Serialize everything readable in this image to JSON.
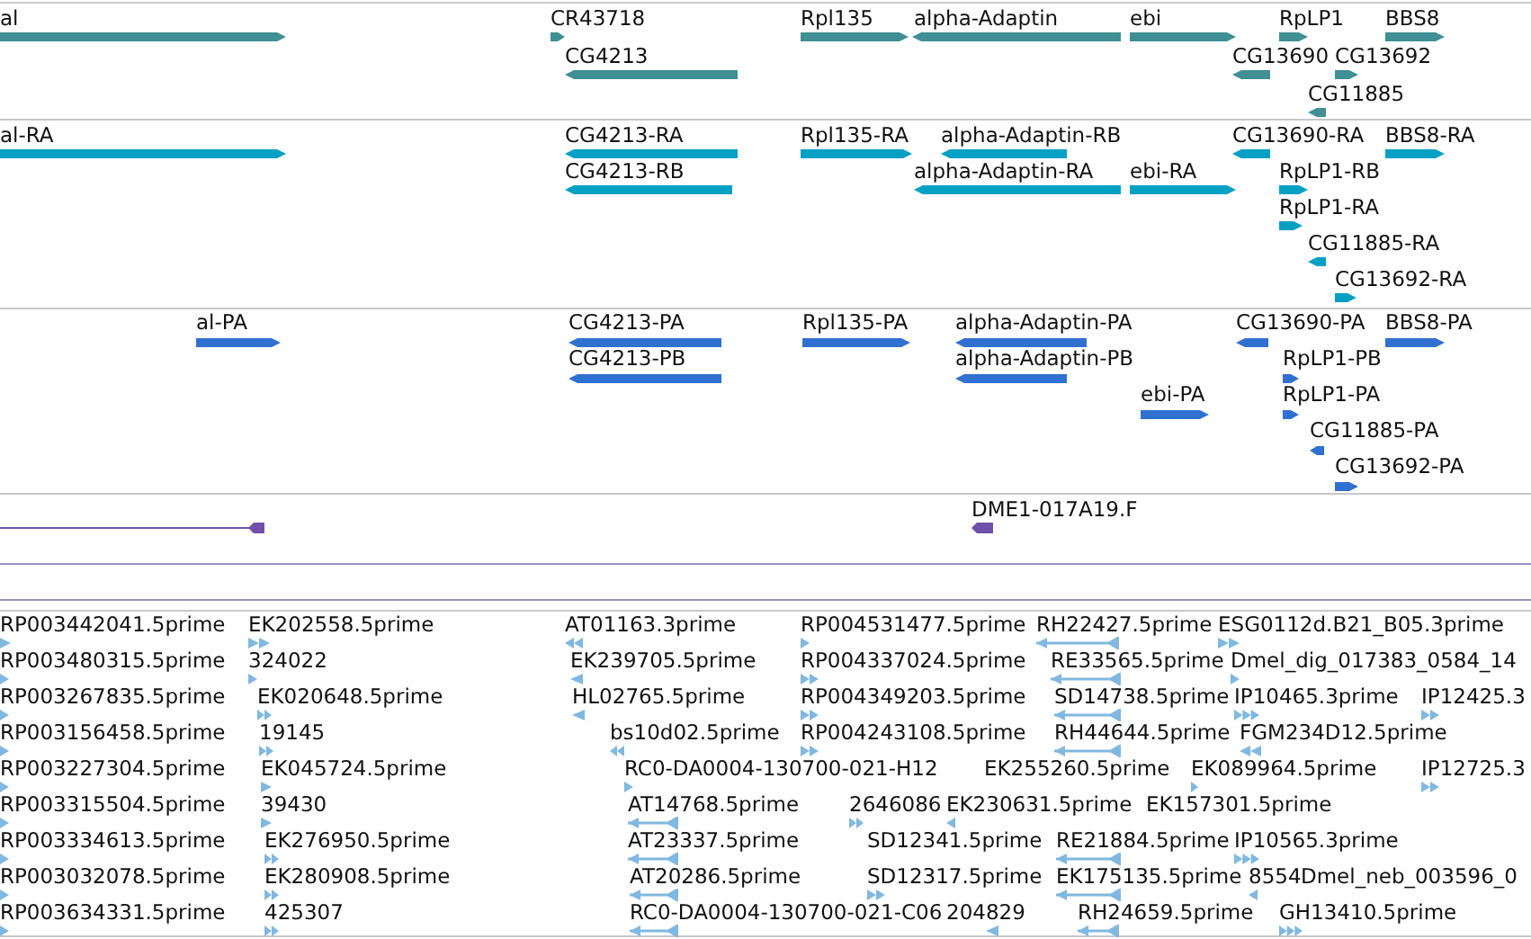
{
  "tracks": [
    {
      "kind": "block",
      "color": "#3f8f94",
      "features": [
        {
          "label": "al",
          "reverse": false
        },
        {
          "label": "CR43718",
          "reverse": false
        },
        {
          "label": "Rpl135",
          "reverse": false
        },
        {
          "label": "alpha-Adaptin",
          "reverse": true
        },
        {
          "label": "ebi",
          "reverse": false
        },
        {
          "label": "RpLP1",
          "reverse": false
        },
        {
          "label": "BBS8",
          "reverse": false
        },
        {
          "label": "CG4213",
          "reverse": true
        },
        {
          "label": "CG13690",
          "reverse": true
        },
        {
          "label": "CG13692",
          "reverse": false
        },
        {
          "label": "CG11885",
          "reverse": true
        }
      ]
    },
    {
      "kind": "block",
      "color": "#00a0c4",
      "features": [
        {
          "label": "al-RA",
          "reverse": false
        },
        {
          "label": "CG4213-RA",
          "reverse": true
        },
        {
          "label": "Rpl135-RA",
          "reverse": false
        },
        {
          "label": "alpha-Adaptin-RB",
          "reverse": true
        },
        {
          "label": "CG13690-RA",
          "reverse": true
        },
        {
          "label": "BBS8-RA",
          "reverse": false
        },
        {
          "label": "CG4213-RB",
          "reverse": true
        },
        {
          "label": "alpha-Adaptin-RA",
          "reverse": true
        },
        {
          "label": "ebi-RA",
          "reverse": false
        },
        {
          "label": "RpLP1-RB",
          "reverse": false
        },
        {
          "label": "RpLP1-RA",
          "reverse": false
        },
        {
          "label": "CG11885-RA",
          "reverse": true
        },
        {
          "label": "CG13692-RA",
          "reverse": false
        }
      ]
    },
    {
      "kind": "block",
      "color": "#3070d0",
      "features": [
        {
          "label": "al-PA",
          "reverse": false
        },
        {
          "label": "CG4213-PA",
          "reverse": true
        },
        {
          "label": "Rpl135-PA",
          "reverse": false
        },
        {
          "label": "alpha-Adaptin-PA",
          "reverse": true
        },
        {
          "label": "CG13690-PA",
          "reverse": true
        },
        {
          "label": "BBS8-PA",
          "reverse": false
        },
        {
          "label": "CG4213-PB",
          "reverse": true
        },
        {
          "label": "alpha-Adaptin-PB",
          "reverse": true
        },
        {
          "label": "RpLP1-PB",
          "reverse": false
        },
        {
          "label": "ebi-PA",
          "reverse": false
        },
        {
          "label": "RpLP1-PA",
          "reverse": false
        },
        {
          "label": "CG11885-PA",
          "reverse": true
        },
        {
          "label": "CG13692-PA",
          "reverse": false
        }
      ]
    },
    {
      "kind": "line",
      "color": "#7050a8",
      "features": [
        {
          "reverse": true
        },
        {
          "label": "DME1-017A19.F",
          "reverse": true
        }
      ]
    },
    {
      "kind": "read",
      "color": "#80b8e0",
      "features": [
        {
          "label": "RP003442041.5prime",
          "reverse": false
        },
        {
          "label": "EK202558.5prime",
          "reverse": false
        },
        {
          "label": "AT01163.3prime",
          "reverse": true
        },
        {
          "label": "RP004531477.5prime",
          "reverse": false
        },
        {
          "label": "RH22427.5prime",
          "reverse": true
        },
        {
          "label": "ESG0112d.B21_B05.3prime",
          "reverse": false
        },
        {
          "label": "RP003480315.5prime",
          "reverse": false
        },
        {
          "label": "324022",
          "reverse": false
        },
        {
          "label": "EK239705.5prime",
          "reverse": true
        },
        {
          "label": "RP004337024.5prime",
          "reverse": false
        },
        {
          "label": "RE33565.5prime",
          "reverse": true
        },
        {
          "label": "Dmel_dig_017383_0584_14",
          "reverse": false
        },
        {
          "label": "RP003267835.5prime",
          "reverse": false
        },
        {
          "label": "EK020648.5prime",
          "reverse": false
        },
        {
          "label": "HL02765.5prime",
          "reverse": true
        },
        {
          "label": "RP004349203.5prime",
          "reverse": false
        },
        {
          "label": "SD14738.5prime",
          "reverse": true
        },
        {
          "label": "IP10465.3prime",
          "reverse": false
        },
        {
          "label": "IP12425.3",
          "reverse": false
        },
        {
          "label": "RP003156458.5prime",
          "reverse": false
        },
        {
          "label": "19145",
          "reverse": false
        },
        {
          "label": "bs10d02.5prime",
          "reverse": true
        },
        {
          "label": "RP004243108.5prime",
          "reverse": false
        },
        {
          "label": "RH44644.5prime",
          "reverse": true
        },
        {
          "label": "FGM234D12.5prime",
          "reverse": true
        },
        {
          "label": "RP003227304.5prime",
          "reverse": false
        },
        {
          "label": "EK045724.5prime",
          "reverse": false
        },
        {
          "label": "RC0-DA0004-130700-021-H12",
          "reverse": false
        },
        {
          "label": "EK255260.5prime"
        },
        {
          "label": "EK089964.5prime",
          "reverse": false
        },
        {
          "label": "IP12725.3",
          "reverse": false
        },
        {
          "label": "RP003315504.5prime",
          "reverse": false
        },
        {
          "label": "39430",
          "reverse": false
        },
        {
          "label": "AT14768.5prime",
          "reverse": true
        },
        {
          "label": "2646086",
          "reverse": false
        },
        {
          "label": "EK230631.5prime",
          "reverse": true
        },
        {
          "label": "EK157301.5prime"
        },
        {
          "label": "RP003334613.5prime",
          "reverse": false
        },
        {
          "label": "EK276950.5prime",
          "reverse": false
        },
        {
          "label": "AT23337.5prime",
          "reverse": true
        },
        {
          "label": "SD12341.5prime"
        },
        {
          "label": "RE21884.5prime",
          "reverse": true
        },
        {
          "label": "IP10565.3prime",
          "reverse": false
        },
        {
          "label": "RP003032078.5prime",
          "reverse": false
        },
        {
          "label": "EK280908.5prime",
          "reverse": false
        },
        {
          "label": "AT20286.5prime",
          "reverse": true
        },
        {
          "label": "SD12317.5prime",
          "reverse": false
        },
        {
          "label": "EK175135.5prime",
          "reverse": true
        },
        {
          "label": "8554",
          "reverse": true
        },
        {
          "label": "Dmel_neb_003596_0"
        },
        {
          "label": "RP003634331.5prime",
          "reverse": false
        },
        {
          "label": "425307",
          "reverse": false
        },
        {
          "label": "RC0-DA0004-130700-021-C06",
          "reverse": true
        },
        {
          "label": "204829",
          "reverse": true
        },
        {
          "label": "RH24659.5prime",
          "reverse": true
        },
        {
          "label": "GH13410.5prime",
          "reverse": false
        }
      ]
    }
  ]
}
